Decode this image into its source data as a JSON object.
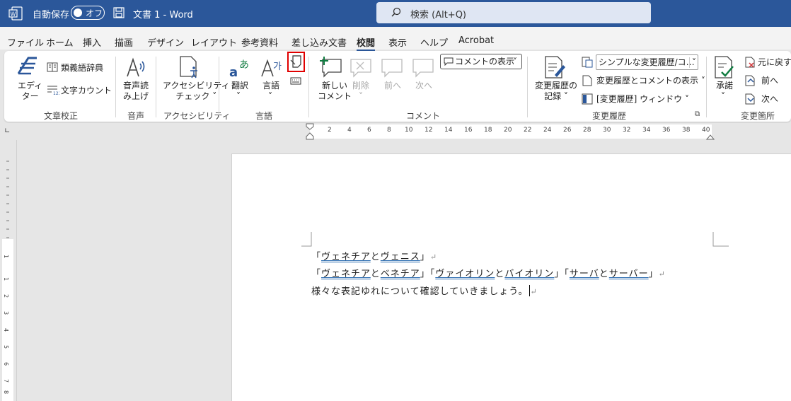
{
  "titlebar": {
    "autosave_label": "自動保存",
    "autosave_state": "オフ",
    "doc_title": "文書 1  -  Word",
    "search_placeholder": "検索 (Alt+Q)",
    "bg_color": "#2b579a"
  },
  "menu": {
    "tabs": [
      "ファイル",
      "ホーム",
      "挿入",
      "描画",
      "デザイン",
      "レイアウト",
      "参考資料",
      "差し込み文書",
      "校閲",
      "表示",
      "ヘルプ",
      "Acrobat"
    ],
    "active_tab": "校閲"
  },
  "ribbon": {
    "proofing": {
      "editor": "エディ\nター",
      "thesaurus": "類義語辞典",
      "word_count": "文字カウント",
      "group": "文章校正"
    },
    "speech": {
      "read_aloud": "音声読\nみ上げ",
      "group": "音声"
    },
    "accessibility": {
      "check": "アクセシビリティ\nチェック ˅",
      "group": "アクセシビリティ"
    },
    "language": {
      "translate": "翻訳",
      "language": "言語",
      "group": "言語"
    },
    "comments": {
      "new": "新しい\nコメント",
      "delete": "削除",
      "previous": "前へ",
      "next": "次へ",
      "show": "コメントの表示",
      "group": "コメント"
    },
    "tracking": {
      "track_changes": "変更履歴の\n記録 ˅",
      "markup": "シンプルな変更履歴/コ…",
      "show_markup": "変更履歴とコメントの表示 ˅",
      "pane": "[変更履歴] ウィンドウ ˅",
      "group": "変更履歴"
    },
    "changes": {
      "accept": "承諾",
      "undo": "元に戻す",
      "previous": "前へ",
      "next": "次へ",
      "group": "変更箇所"
    }
  },
  "ruler": {
    "h_ticks": [
      "2",
      "4",
      "6",
      "8",
      "10",
      "12",
      "14",
      "16",
      "18",
      "20",
      "22",
      "24",
      "26",
      "28",
      "30",
      "32",
      "34",
      "36",
      "38",
      "40"
    ],
    "v_ticks": [
      "1",
      "1",
      "2",
      "3",
      "4",
      "5",
      "6",
      "7",
      "8",
      "9"
    ]
  },
  "document": {
    "line1": {
      "parts": [
        "「",
        "ヴェネチア",
        "と",
        "ヴェニス",
        "」"
      ]
    },
    "line2": {
      "parts": [
        "「",
        "ヴェネチア",
        "と",
        "ベネチア",
        "」「",
        "ヴァイオリン",
        "と",
        "バイオリン",
        "」「",
        "サーバ",
        "と",
        "サーバー",
        "」"
      ]
    },
    "line3": "様々な表記ゆれについて確認していきましょう。",
    "pilcrow": "↵"
  }
}
